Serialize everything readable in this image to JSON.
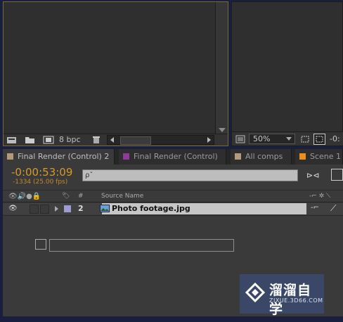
{
  "project_panel": {
    "bit_depth": "8 bpc",
    "icons": [
      "interpret-footage-icon",
      "new-folder-icon",
      "new-comp-icon",
      "trash-icon"
    ]
  },
  "comp_panel": {
    "zoom": "50%",
    "partial_timecode": "-0:"
  },
  "tabs": [
    {
      "label": "Final Render (Control) 2",
      "color": "#b39a7a"
    },
    {
      "label": "Final Render (Control)",
      "color": "#8e3a9a"
    },
    {
      "label": "All comps",
      "color": "#b39a7a"
    },
    {
      "label": "Scene 1",
      "color": "#e8901a"
    }
  ],
  "timeline": {
    "timecode": "-0:00:53:09",
    "frames": "-1334 (25.00 fps)",
    "search_placeholder": "ρˇ",
    "header": {
      "number_col": "#",
      "source_name": "Source Name"
    },
    "layer": {
      "number": "2",
      "name": "Photo footage.jpg",
      "label_color": "#9c9cd0"
    }
  },
  "watermark": {
    "title": "溜溜自学",
    "subtitle": "ZIXUE.3D66.COM"
  }
}
